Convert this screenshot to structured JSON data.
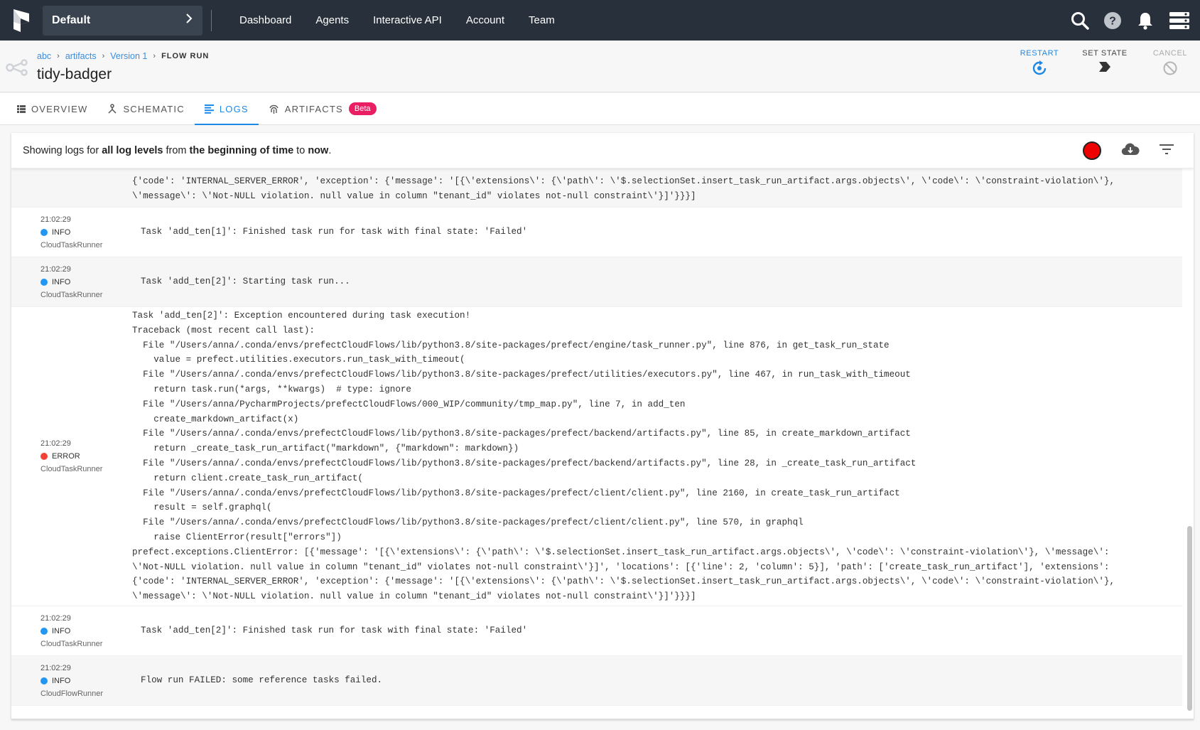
{
  "nav": {
    "project": "Default",
    "links": [
      "Dashboard",
      "Agents",
      "Interactive API",
      "Account",
      "Team"
    ]
  },
  "breadcrumb": {
    "items": [
      "abc",
      "artifacts",
      "Version 1"
    ],
    "current": "FLOW RUN"
  },
  "run_name": "tidy-badger",
  "actions": {
    "restart": "RESTART",
    "set_state": "SET STATE",
    "cancel": "CANCEL"
  },
  "tabs": {
    "overview": "OVERVIEW",
    "schematic": "SCHEMATIC",
    "logs": "LOGS",
    "artifacts": "ARTIFACTS",
    "beta": "Beta"
  },
  "log_filter": {
    "prefix": "Showing logs for ",
    "levels": "all log levels",
    "mid1": " from ",
    "from": "the beginning of time",
    "mid2": " to ",
    "to": "now",
    "suffix": "."
  },
  "colors": {
    "info": "#2196f3",
    "error": "#f44336",
    "accent": "#1e88e5"
  },
  "logs": [
    {
      "time": "",
      "level": "",
      "source": "",
      "message": "{'code': 'INTERNAL_SERVER_ERROR', 'exception': {'message': '[{\\'extensions\\': {\\'path\\': \\'$.selectionSet.insert_task_run_artifact.args.objects\\', \\'code\\': \\'constraint-violation\\'},\n\\'message\\': \\'Not-NULL violation. null value in column \"tenant_id\" violates not-null constraint\\'}]'}}}]"
    },
    {
      "time": "21:02:29",
      "level": "INFO",
      "source": "CloudTaskRunner",
      "message": "Task 'add_ten[1]': Finished task run for task with final state: 'Failed'"
    },
    {
      "time": "21:02:29",
      "level": "INFO",
      "source": "CloudTaskRunner",
      "message": "Task 'add_ten[2]': Starting task run..."
    },
    {
      "time": "21:02:29",
      "level": "ERROR",
      "source": "CloudTaskRunner",
      "message": "Task 'add_ten[2]': Exception encountered during task execution!\nTraceback (most recent call last):\n  File \"/Users/anna/.conda/envs/prefectCloudFlows/lib/python3.8/site-packages/prefect/engine/task_runner.py\", line 876, in get_task_run_state\n    value = prefect.utilities.executors.run_task_with_timeout(\n  File \"/Users/anna/.conda/envs/prefectCloudFlows/lib/python3.8/site-packages/prefect/utilities/executors.py\", line 467, in run_task_with_timeout\n    return task.run(*args, **kwargs)  # type: ignore\n  File \"/Users/anna/PycharmProjects/prefectCloudFlows/000_WIP/community/tmp_map.py\", line 7, in add_ten\n    create_markdown_artifact(x)\n  File \"/Users/anna/.conda/envs/prefectCloudFlows/lib/python3.8/site-packages/prefect/backend/artifacts.py\", line 85, in create_markdown_artifact\n    return _create_task_run_artifact(\"markdown\", {\"markdown\": markdown})\n  File \"/Users/anna/.conda/envs/prefectCloudFlows/lib/python3.8/site-packages/prefect/backend/artifacts.py\", line 28, in _create_task_run_artifact\n    return client.create_task_run_artifact(\n  File \"/Users/anna/.conda/envs/prefectCloudFlows/lib/python3.8/site-packages/prefect/client/client.py\", line 2160, in create_task_run_artifact\n    result = self.graphql(\n  File \"/Users/anna/.conda/envs/prefectCloudFlows/lib/python3.8/site-packages/prefect/client/client.py\", line 570, in graphql\n    raise ClientError(result[\"errors\"])\nprefect.exceptions.ClientError: [{'message': '[{\\'extensions\\': {\\'path\\': \\'$.selectionSet.insert_task_run_artifact.args.objects\\', \\'code\\': \\'constraint-violation\\'}, \\'message\\':\n\\'Not-NULL violation. null value in column \"tenant_id\" violates not-null constraint\\'}]', 'locations': [{'line': 2, 'column': 5}], 'path': ['create_task_run_artifact'], 'extensions':\n{'code': 'INTERNAL_SERVER_ERROR', 'exception': {'message': '[{\\'extensions\\': {\\'path\\': \\'$.selectionSet.insert_task_run_artifact.args.objects\\', \\'code\\': \\'constraint-violation\\'},\n\\'message\\': \\'Not-NULL violation. null value in column \"tenant_id\" violates not-null constraint\\'}]'}}}]"
    },
    {
      "time": "21:02:29",
      "level": "INFO",
      "source": "CloudTaskRunner",
      "message": "Task 'add_ten[2]': Finished task run for task with final state: 'Failed'"
    },
    {
      "time": "21:02:29",
      "level": "INFO",
      "source": "CloudFlowRunner",
      "message": "Flow run FAILED: some reference tasks failed."
    }
  ]
}
